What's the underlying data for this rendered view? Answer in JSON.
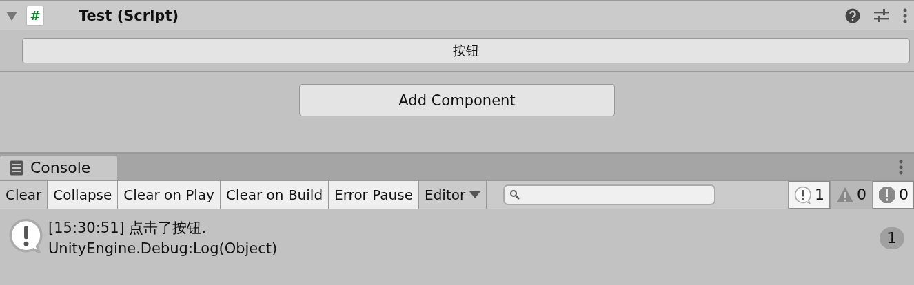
{
  "component": {
    "expanded": true,
    "script_glyph": "#",
    "title": "Test (Script)"
  },
  "inspector_button": "按钮",
  "add_component": "Add Component",
  "console": {
    "tab": "Console",
    "toolbar": [
      {
        "kind": "button",
        "label": "Clear"
      },
      {
        "kind": "toggle",
        "label": "Collapse",
        "selected": true
      },
      {
        "kind": "toggle",
        "label": "Clear on Play",
        "selected": true
      },
      {
        "kind": "toggle",
        "label": "Clear on Build",
        "selected": true
      },
      {
        "kind": "toggle",
        "label": "Error Pause",
        "selected": true
      },
      {
        "kind": "dropdown",
        "label": "Editor"
      }
    ],
    "counters": [
      {
        "kind": "log",
        "count": "1",
        "selected": true
      },
      {
        "kind": "warning",
        "count": "0",
        "selected": false
      },
      {
        "kind": "error",
        "count": "0",
        "selected": true
      }
    ],
    "entries": [
      {
        "kind": "log",
        "message": "[15:30:51] 点击了按钮.",
        "stack": "UnityEngine.Debug:Log(Object)",
        "count": "1"
      }
    ]
  }
}
